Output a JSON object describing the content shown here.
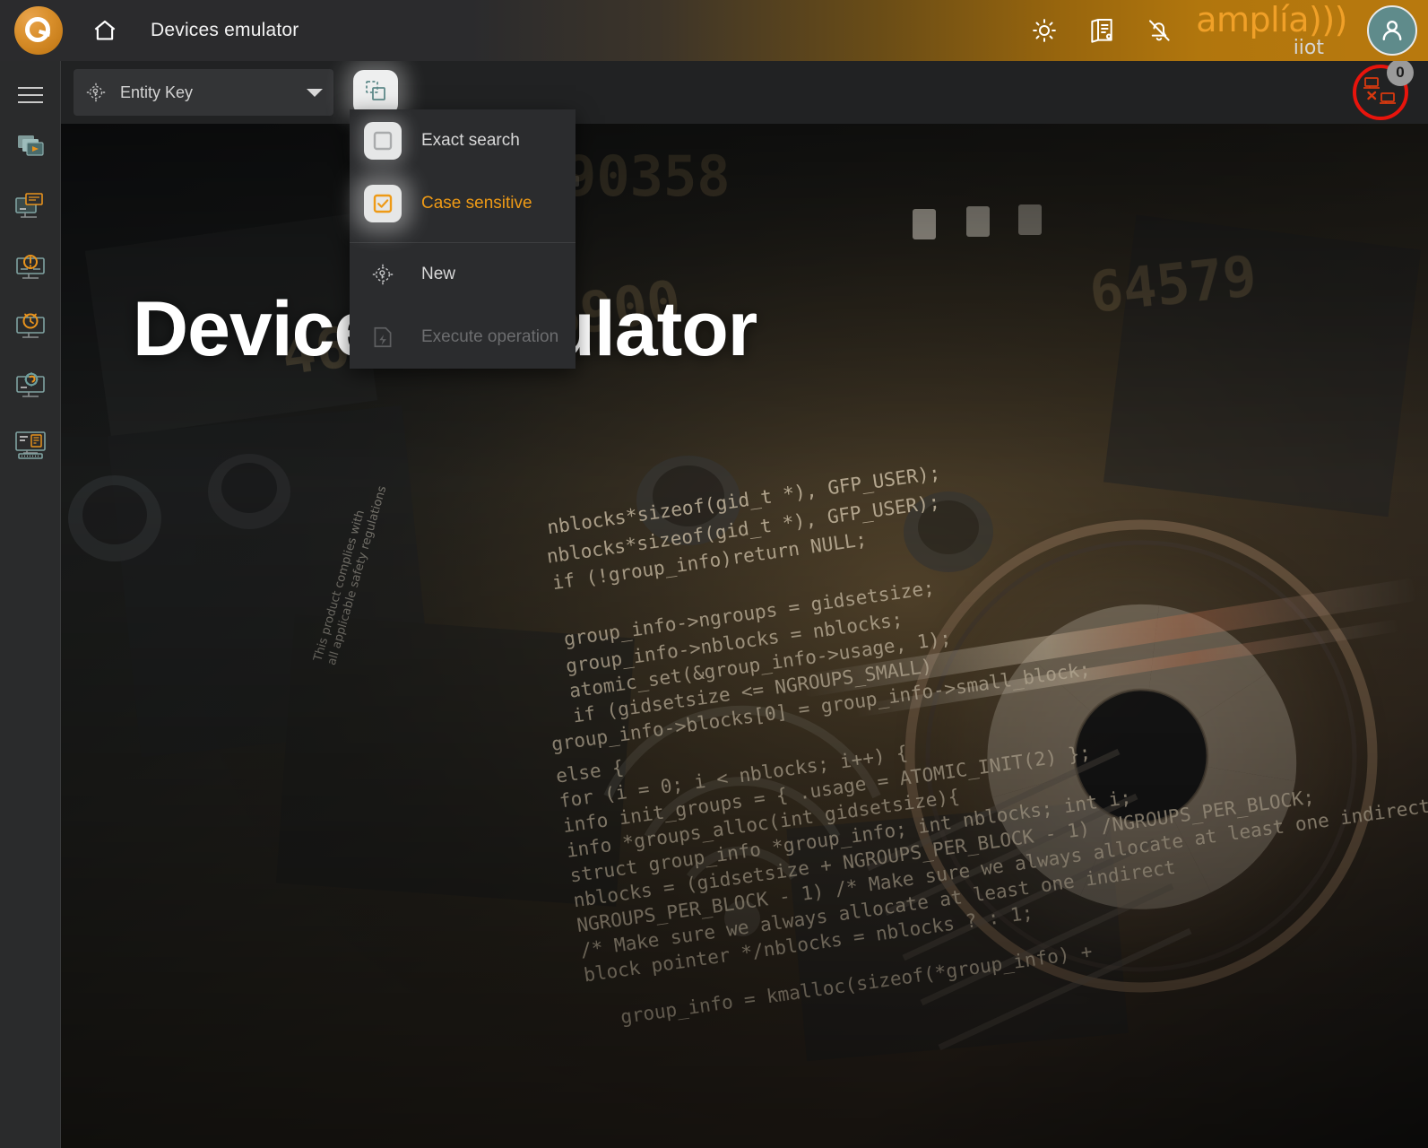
{
  "header": {
    "logo_icon": "amplia-q-logo-icon",
    "home_icon": "home-icon",
    "title": "Devices emulator",
    "actions": [
      {
        "name": "brightness-icon",
        "label": "Brightness"
      },
      {
        "name": "logbook-icon",
        "label": "Logbook"
      },
      {
        "name": "notifications-off-icon",
        "label": "Notifications off"
      }
    ],
    "brand_main": "amplía)))",
    "brand_sub": "iiot",
    "avatar_icon": "user-avatar-icon"
  },
  "sidebar": {
    "menu_toggle": "hamburger-icon",
    "items": [
      {
        "name": "sidebar-item-simulations",
        "icon": "layers-play-icon"
      },
      {
        "name": "sidebar-item-devices",
        "icon": "monitor-card-icon"
      },
      {
        "name": "sidebar-item-alarms",
        "icon": "monitor-alert-icon"
      },
      {
        "name": "sidebar-item-scheduler",
        "icon": "monitor-clock-icon"
      },
      {
        "name": "sidebar-item-settings",
        "icon": "monitor-gear-icon"
      },
      {
        "name": "sidebar-item-terminal",
        "icon": "monitor-terminal-icon"
      }
    ]
  },
  "toolbar": {
    "search": {
      "icon": "entity-key-icon",
      "value": "Entity Key",
      "placeholder": "Entity Key",
      "caret_icon": "chevron-down-icon"
    },
    "options_toggle": {
      "name": "search-options-toggle",
      "icon": "duplicate-square-icon"
    },
    "disconnected": {
      "icon": "disconnected-devices-icon",
      "badge": "0"
    }
  },
  "menu": {
    "items": [
      {
        "label": "Exact search",
        "icon": "checkbox-unchecked-icon",
        "state": "unchecked",
        "disabled": false,
        "accent": false
      },
      {
        "label": "Case sensitive",
        "icon": "checkbox-checked-icon",
        "state": "checked",
        "disabled": false,
        "accent": true
      },
      {
        "label": "New",
        "icon": "entity-key-icon",
        "state": "action",
        "disabled": false,
        "accent": false
      },
      {
        "label": "Execute operation",
        "icon": "execute-operation-icon",
        "state": "action",
        "disabled": true,
        "accent": false
      }
    ]
  },
  "main": {
    "hero_title": "Devices emulator"
  },
  "colors": {
    "accent_orange": "#ee9a16",
    "brand_orange": "#f0a028",
    "teal": "#5f8b8b",
    "alert_red": "#e8140c",
    "header_dark": "#2b2b2d",
    "sidebar_bg": "#2a2b2c",
    "toolbar_bg": "#212223",
    "menu_bg": "#2b2c2e"
  }
}
